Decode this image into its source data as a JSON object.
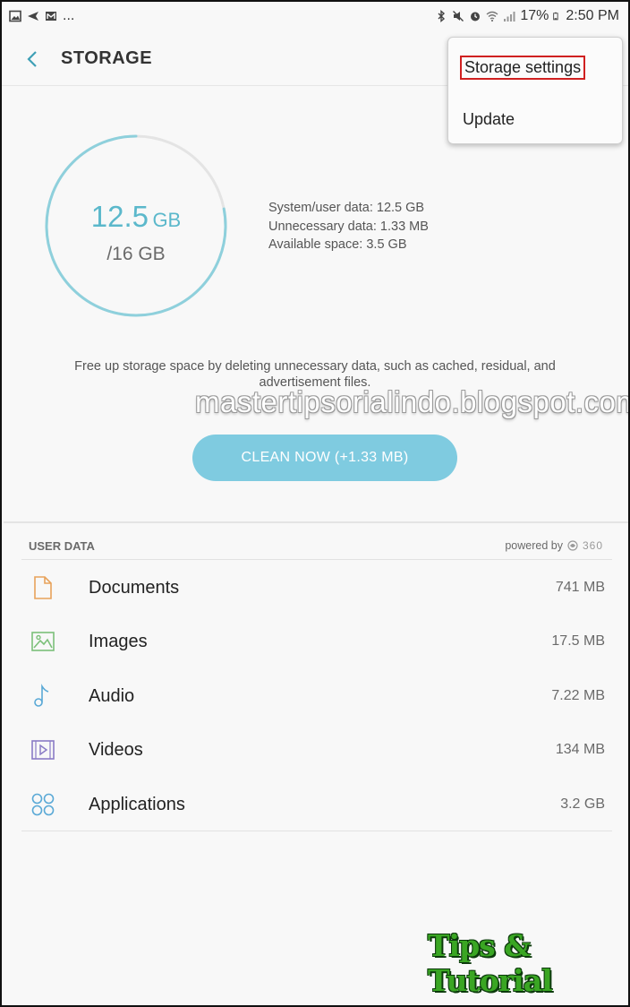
{
  "status_bar": {
    "left_icons": [
      "image-icon",
      "send-icon",
      "mail-icon"
    ],
    "more": "...",
    "right_icons": [
      "bluetooth-icon",
      "mute-icon",
      "alarm-icon",
      "wifi-icon",
      "signal-icon"
    ],
    "battery_percent": "17%",
    "time": "2:50 PM"
  },
  "header": {
    "title": "STORAGE"
  },
  "menu": {
    "items": [
      {
        "label": "Storage settings"
      },
      {
        "label": "Update"
      }
    ],
    "highlight_color": "#d02020"
  },
  "gauge": {
    "used_value": "12.5",
    "used_unit": "GB",
    "total": "/16 GB",
    "used_fraction": 0.78,
    "ring_color": "#8ed0dc",
    "track_color": "#e4e4e4"
  },
  "stats": [
    "System/user data: 12.5 GB",
    "Unnecessary data: 1.33 MB",
    "Available space: 3.5 GB"
  ],
  "description": "Free up storage space by deleting unnecessary data, such as cached, residual, and advertisement files.",
  "watermark": "mastertipsorialindo.blogspot.com",
  "clean_button": {
    "label": "CLEAN NOW (+1.33 MB)",
    "color": "#7fcbe0"
  },
  "user_data": {
    "section_label": "USER DATA",
    "powered_by": "powered by",
    "provider": "360",
    "items": [
      {
        "label": "Documents",
        "size": "741 MB",
        "icon": "document-icon",
        "color": "#e8a25a"
      },
      {
        "label": "Images",
        "size": "17.5 MB",
        "icon": "image-icon",
        "color": "#7cc07a"
      },
      {
        "label": "Audio",
        "size": "7.22 MB",
        "icon": "music-note-icon",
        "color": "#5aa9d6"
      },
      {
        "label": "Videos",
        "size": "134 MB",
        "icon": "video-icon",
        "color": "#8a7cc6"
      },
      {
        "label": "Applications",
        "size": "3.2 GB",
        "icon": "apps-icon",
        "color": "#5aa9d6"
      }
    ]
  },
  "logo": "Tips & Tutorial"
}
